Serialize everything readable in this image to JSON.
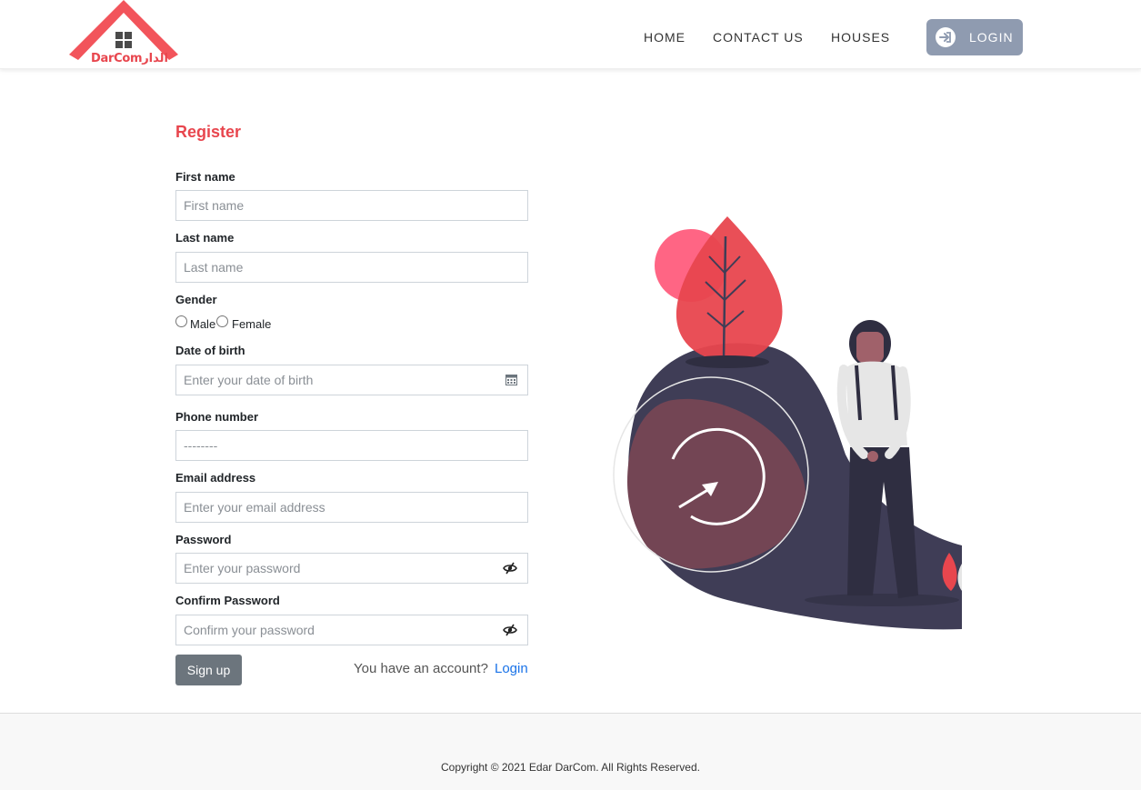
{
  "header": {
    "logo_text": "DarComالدار",
    "nav": {
      "home": "HOME",
      "contact": "CONTACT US",
      "houses": "HOUSES"
    },
    "login_label": "LOGIN"
  },
  "form": {
    "title": "Register",
    "first_name": {
      "label": "First name",
      "placeholder": "First name"
    },
    "last_name": {
      "label": "Last name",
      "placeholder": "Last name"
    },
    "gender": {
      "label": "Gender",
      "male": "Male",
      "female": "Female"
    },
    "dob": {
      "label": "Date of birth",
      "placeholder": "Enter your date of birth"
    },
    "phone": {
      "label": "Phone number",
      "placeholder": "--------"
    },
    "email": {
      "label": "Email address",
      "placeholder": "Enter your email address"
    },
    "password": {
      "label": "Password",
      "placeholder": "Enter your password"
    },
    "confirm_password": {
      "label": "Confirm Password",
      "placeholder": "Confirm your password"
    },
    "signup_label": "Sign up",
    "have_account": "You have an account?",
    "login_link": "Login"
  },
  "footer": {
    "copyright": "Copyright © 2021 Edar DarCom. All Rights Reserved."
  },
  "colors": {
    "brand": "#e8464e",
    "login_button": "#8f9bb0",
    "signup_button": "#6c757d",
    "link": "#1a73e8"
  },
  "icons": {
    "login": "login-arrow-icon",
    "eye": "eye-slash-icon",
    "calendar": "calendar-icon"
  }
}
